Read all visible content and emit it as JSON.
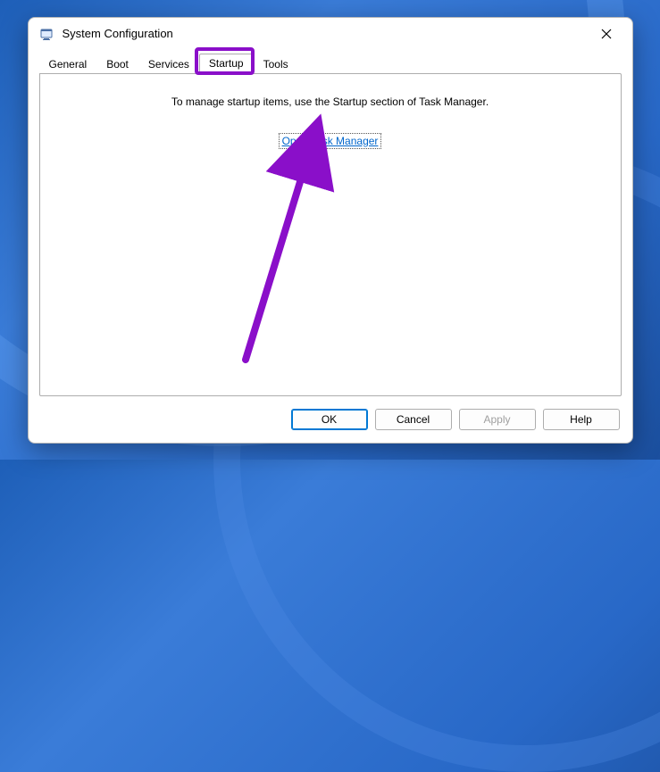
{
  "window": {
    "title": "System Configuration"
  },
  "tabs": {
    "general": "General",
    "boot": "Boot",
    "services": "Services",
    "startup": "Startup",
    "tools": "Tools",
    "active": "startup"
  },
  "content": {
    "instruction": "To manage startup items, use the Startup section of Task Manager.",
    "link": "Open Task Manager"
  },
  "buttons": {
    "ok": "OK",
    "cancel": "Cancel",
    "apply": "Apply",
    "help": "Help"
  },
  "annotation": {
    "highlight_color": "#8a0fc9",
    "arrow_color": "#8a0fc9"
  }
}
